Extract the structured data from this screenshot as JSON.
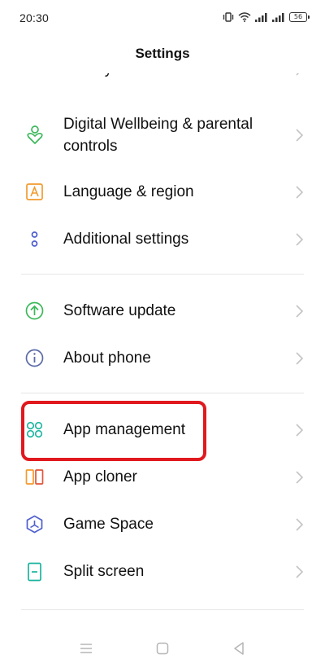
{
  "status_bar": {
    "time": "20:30",
    "battery_level": "56",
    "icons": [
      "vibrate-icon",
      "wifi-icon",
      "signal-icon",
      "signal-icon",
      "battery-icon"
    ]
  },
  "header": {
    "title": "Settings"
  },
  "settings_items": [
    {
      "id": "battery",
      "label": "Battery",
      "icon": "battery-icon"
    },
    {
      "id": "digital-wellbeing",
      "label_line1": "Digital Wellbeing & parental",
      "label_line2": "controls",
      "icon": "wellbeing-icon"
    },
    {
      "id": "language",
      "label": "Language & region",
      "icon": "language-icon"
    },
    {
      "id": "additional",
      "label": "Additional settings",
      "icon": "additional-settings-icon"
    },
    {
      "id": "software-update",
      "label": "Software update",
      "icon": "update-icon"
    },
    {
      "id": "about-phone",
      "label": "About phone",
      "icon": "info-icon"
    },
    {
      "id": "app-management",
      "label": "App management",
      "icon": "app-management-icon"
    },
    {
      "id": "app-cloner",
      "label": "App cloner",
      "icon": "app-cloner-icon"
    },
    {
      "id": "game-space",
      "label": "Game Space",
      "icon": "game-space-icon"
    },
    {
      "id": "split-screen",
      "label": "Split screen",
      "icon": "split-screen-icon"
    }
  ],
  "highlight": {
    "target": "app-management",
    "color": "#e0191f"
  },
  "nav_bar": {
    "buttons": [
      "menu-icon",
      "home-icon",
      "back-icon"
    ]
  },
  "colors": {
    "teal": "#1ab59f",
    "green": "#3bb85a",
    "orange": "#f29b2e",
    "purple": "#4f5fcf",
    "blue_gray": "#5b6aa8",
    "chevron": "#c4c4c4"
  }
}
